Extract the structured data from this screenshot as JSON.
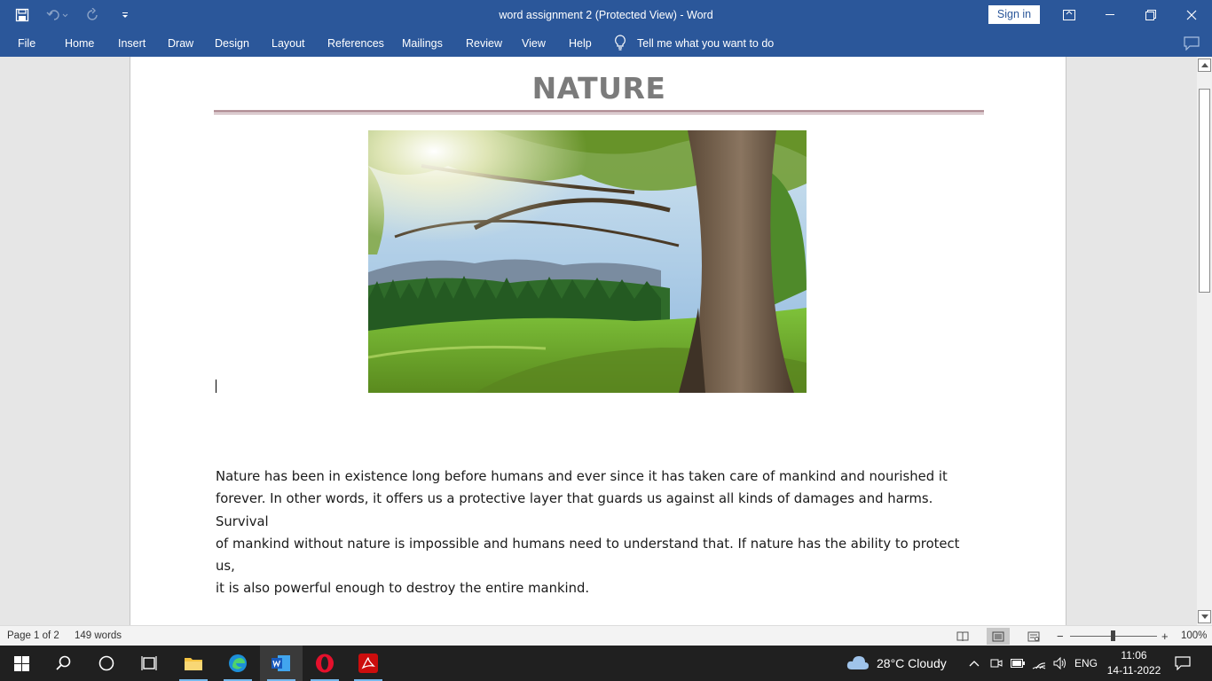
{
  "window": {
    "title": "word assignment 2 (Protected View)  -  Word",
    "sign_in": "Sign in"
  },
  "ribbon": {
    "tabs": [
      "File",
      "Home",
      "Insert",
      "Draw",
      "Design",
      "Layout",
      "References",
      "Mailings",
      "Review",
      "View",
      "Help"
    ],
    "tell_me": "Tell me what you want to do"
  },
  "document": {
    "heading": "NATURE",
    "paragraph_lines": [
      "Nature has been in existence long before humans and ever since it has taken care of mankind and nourished it",
      "forever. In other words, it offers us a protective layer that guards us against all kinds of damages and harms. Survival",
      "of mankind without nature is impossible and humans need to understand that. If nature has the ability to protect us,",
      "it is also powerful enough to destroy the entire mankind."
    ]
  },
  "status": {
    "page": "Page 1 of 2",
    "words": "149 words",
    "zoom": "100%"
  },
  "taskbar": {
    "weather": "28°C  Cloudy",
    "language": "ENG",
    "time": "11:06",
    "date": "14-11-2022"
  },
  "colors": {
    "word_blue": "#2b579a",
    "heading_gray": "#7b7b7b",
    "rule_mauve": "#b7979e",
    "taskbar": "#202020"
  }
}
